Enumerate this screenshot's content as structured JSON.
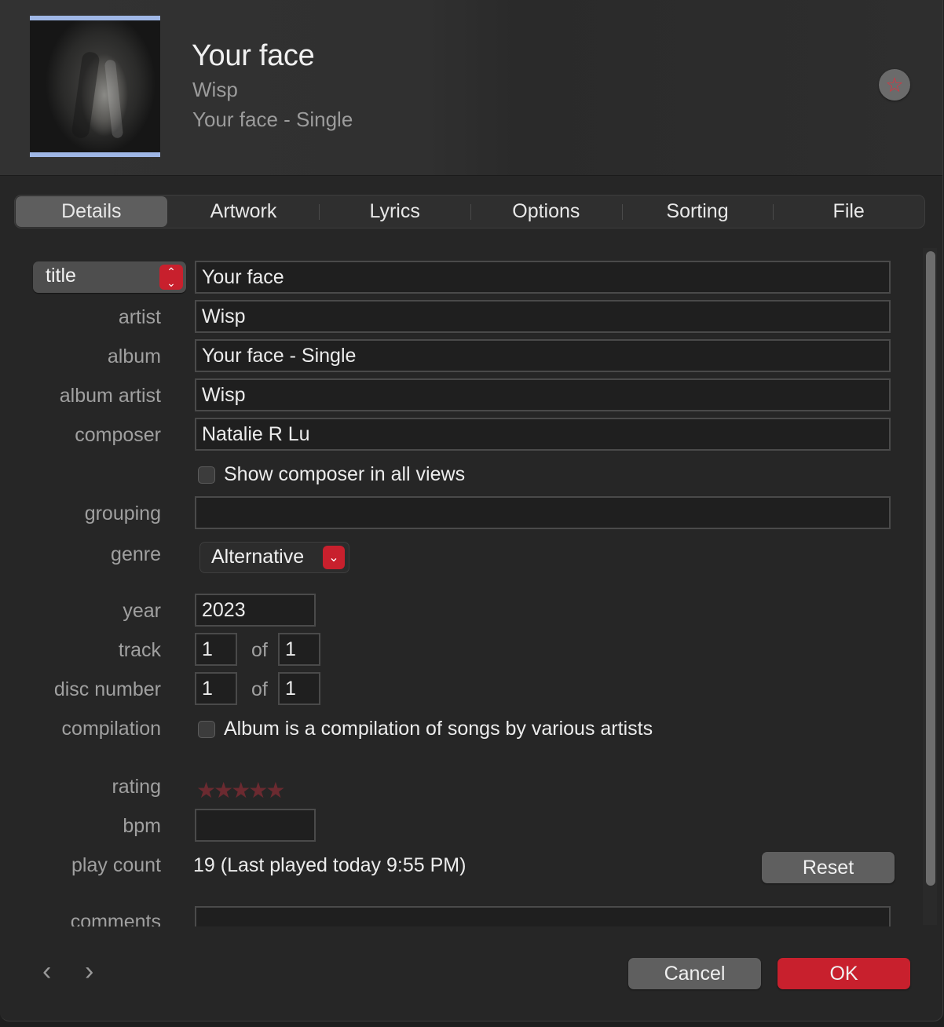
{
  "header": {
    "title": "Your face",
    "artist": "Wisp",
    "album": "Your face - Single",
    "love_icon": "star-icon"
  },
  "tabs": [
    {
      "label": "Details",
      "active": true
    },
    {
      "label": "Artwork",
      "active": false
    },
    {
      "label": "Lyrics",
      "active": false
    },
    {
      "label": "Options",
      "active": false
    },
    {
      "label": "Sorting",
      "active": false
    },
    {
      "label": "File",
      "active": false
    }
  ],
  "details": {
    "title_selector": "title",
    "title": "Your face",
    "labels": {
      "artist": "artist",
      "album": "album",
      "album_artist": "album artist",
      "composer": "composer",
      "grouping": "grouping",
      "genre": "genre",
      "year": "year",
      "track": "track",
      "disc_number": "disc number",
      "compilation": "compilation",
      "rating": "rating",
      "bpm": "bpm",
      "play_count": "play count",
      "comments": "comments",
      "of": "of"
    },
    "artist": "Wisp",
    "album": "Your face - Single",
    "album_artist": "Wisp",
    "composer": "Natalie R Lu",
    "show_composer_label": "Show composer in all views",
    "show_composer_checked": false,
    "grouping": "",
    "genre": "Alternative",
    "year": "2023",
    "track": "1",
    "track_of": "1",
    "disc": "1",
    "disc_of": "1",
    "compilation_label": "Album is a compilation of songs by various artists",
    "compilation_checked": false,
    "rating_stars": "★★★★★",
    "rating_value": 0,
    "bpm": "",
    "play_count": "19 (Last played today 9:55 PM)",
    "reset_label": "Reset",
    "comments": ""
  },
  "footer": {
    "prev": "‹",
    "next": "›",
    "cancel_label": "Cancel",
    "ok_label": "OK"
  },
  "colors": {
    "accent": "#c8202d",
    "background": "#262626"
  }
}
